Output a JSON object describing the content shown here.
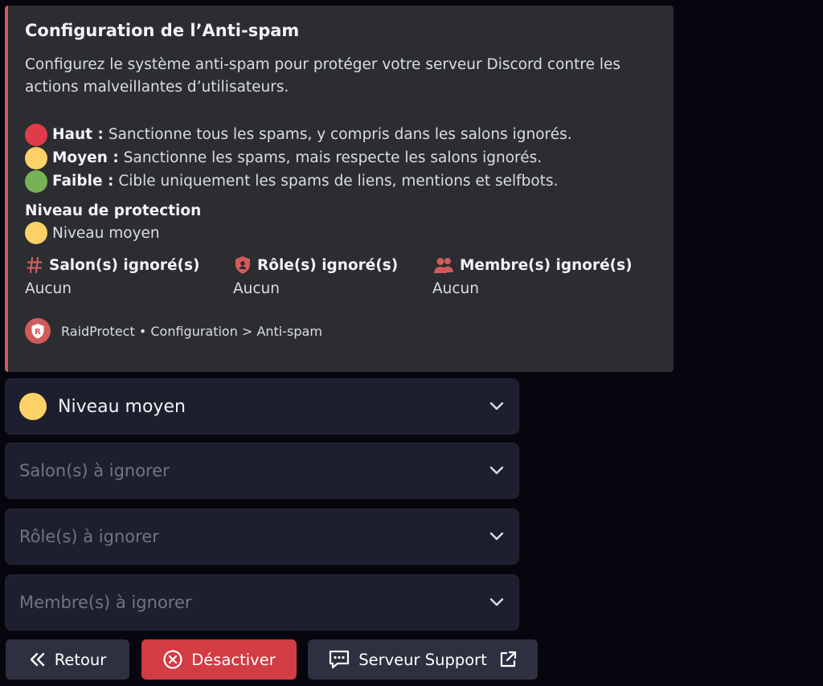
{
  "embed": {
    "accent_color": "#d25b5b",
    "title": "Configuration de l’Anti-spam",
    "description": "Configurez le système anti-spam pour protéger votre serveur Discord contre les actions malveillantes d’utilisateurs.",
    "levels": [
      {
        "icon": "red-circle-icon",
        "color": "#dd3c48",
        "name": "Haut :",
        "text": "Sanctionne tous les spams, y compris dans les salons ignorés."
      },
      {
        "icon": "yellow-circle-icon",
        "color": "#fcd167",
        "name": "Moyen :",
        "text": "Sanctionne les spams, mais respecte les salons ignorés."
      },
      {
        "icon": "green-circle-icon",
        "color": "#77b255",
        "name": "Faible :",
        "text": "Cible uniquement les spams de liens, mentions et selfbots."
      }
    ],
    "protection_field": {
      "name": "Niveau de protection",
      "icon": "yellow-circle-icon",
      "value": "Niveau moyen"
    },
    "inline_fields": [
      {
        "icon": "hashtag-icon",
        "name": "Salon(s) ignoré(s)",
        "value": "Aucun"
      },
      {
        "icon": "shield-icon",
        "name": "Rôle(s) ignoré(s)",
        "value": "Aucun"
      },
      {
        "icon": "members-icon",
        "name": "Membre(s) ignoré(s)",
        "value": "Aucun"
      }
    ],
    "footer": {
      "icon": "raidprotect-logo",
      "text": "RaidProtect • Configuration > Anti-spam"
    }
  },
  "selects": {
    "level": {
      "icon": "yellow-circle-icon",
      "value": "Niveau moyen"
    },
    "channels": {
      "placeholder": "Salon(s) à ignorer"
    },
    "roles": {
      "placeholder": "Rôle(s) à ignorer"
    },
    "members": {
      "placeholder": "Membre(s) à ignorer"
    }
  },
  "buttons": {
    "back": {
      "icon": "double-chevron-left-icon",
      "label": "Retour"
    },
    "disable": {
      "icon": "circle-x-icon",
      "label": "Désactiver",
      "color": "#d23c43"
    },
    "support": {
      "icon": "chat-bubble-icon",
      "label": "Serveur Support",
      "trailing_icon": "external-link-icon"
    }
  }
}
